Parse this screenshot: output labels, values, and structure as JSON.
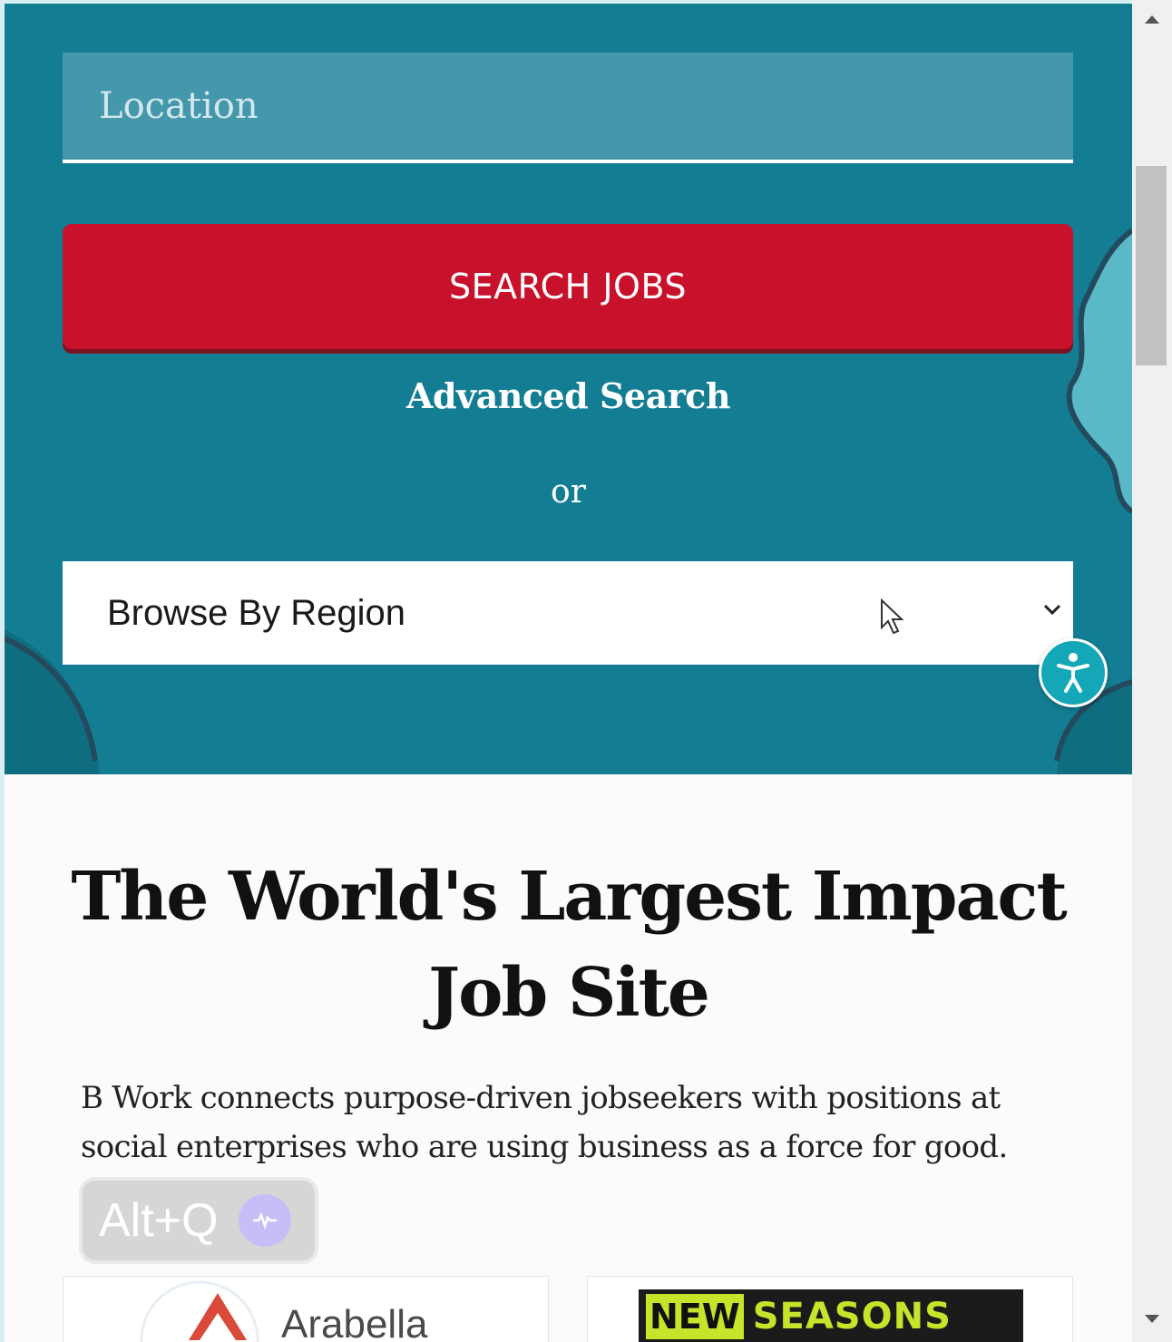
{
  "search": {
    "location_placeholder": "Location",
    "submit_label": "SEARCH JOBS",
    "advanced_label": "Advanced Search",
    "or_label": "or",
    "region_select": {
      "selected": "Browse By Region"
    }
  },
  "hero_content": {
    "headline": "The World's Largest Impact Job Site",
    "tagline": "B Work connects purpose-driven jobseekers with positions at social enterprises who are using business as a force for good."
  },
  "overlay": {
    "hotkey_label": "Alt+Q"
  },
  "partners": [
    {
      "name": "Arabella"
    },
    {
      "name_word1": "NEW",
      "name_word2": "SEASONS"
    }
  ],
  "colors": {
    "hero_bg": "#137e93",
    "search_button": "#c8112b",
    "accessibility_button": "#14a7b8"
  },
  "icons": [
    "chevron-down-icon",
    "mouse-cursor-icon",
    "accessibility-icon",
    "voice-wave-icon",
    "scroll-up-arrow-icon",
    "scroll-down-arrow-icon"
  ]
}
